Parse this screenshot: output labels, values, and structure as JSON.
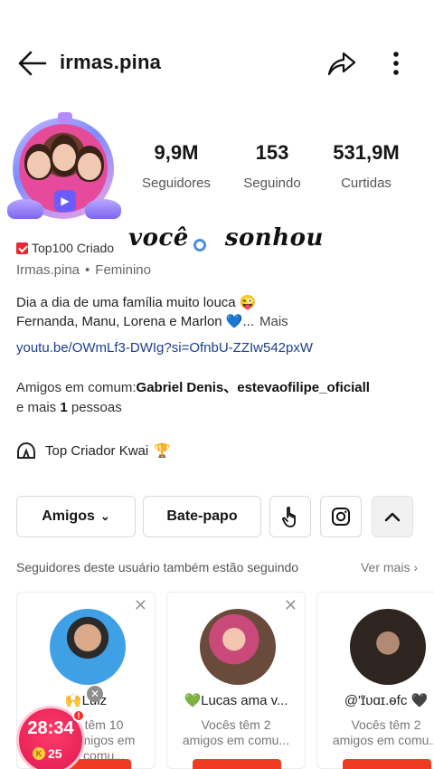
{
  "header": {
    "username": "irmas.pina"
  },
  "stats": [
    {
      "value": "9,9M",
      "label": "Seguidores"
    },
    {
      "value": "153",
      "label": "Seguindo"
    },
    {
      "value": "531,9M",
      "label": "Curtidas"
    }
  ],
  "badge": {
    "text": "Top100 Criado"
  },
  "overlay": {
    "word1": "você",
    "word2": "sonhou"
  },
  "meta": {
    "handle": "Irmas.pina",
    "separator": "•",
    "gender": "Feminino"
  },
  "bio": {
    "line1": "Dia a dia de uma família muito louca 😜",
    "line2": "Fernanda, Manu, Lorena e Marlon 💙...",
    "more": "Mais"
  },
  "link": "youtu.be/OWmLf3-DWIg?si=OfnbU-ZZIw542pxW",
  "mutual": {
    "prefix": "Amigos em comum:",
    "names": "Gabriel Denis、estevaofilipe_oficiall",
    "suffix_a": "e mais ",
    "count": "1",
    "suffix_b": " pessoas"
  },
  "top_criador": {
    "text": "Top Criador Kwai",
    "trophy": "🏆"
  },
  "actions": {
    "amigos": "Amigos",
    "chevron": "⌄",
    "bate_papo": "Bate-papo",
    "collapse": "⌃"
  },
  "followers_section": {
    "title": "Seguidores deste usuário também estão seguindo",
    "ver_mais": "Ver mais ›"
  },
  "cards": [
    {
      "name": "🙌Luiz",
      "sub_line1": "têm 10",
      "sub_line2": "amigos em comu..."
    },
    {
      "name": "💚Lucas ama v...",
      "sub_line1": "Vocês têm 2",
      "sub_line2": "amigos em comu..."
    },
    {
      "name": "@'ɪ̃ᴜɑɪ.ɵfc 🖤",
      "sub_line1": "Vocês têm 2",
      "sub_line2": "amigos em comu..."
    }
  ],
  "card_close": "✕",
  "timer": {
    "time": "28:34",
    "coins": "25",
    "coin_symbol": "K",
    "alert": "!",
    "close": "✕"
  },
  "colors": {
    "accent_red": "#ef3b24",
    "link_blue": "#1d3f8a"
  }
}
